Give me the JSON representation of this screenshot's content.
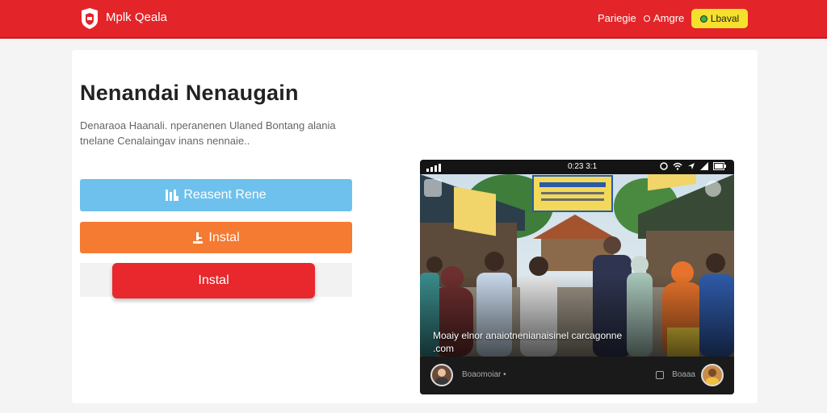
{
  "header": {
    "brand": "Mplk Qeala",
    "nav": [
      "Pariegie",
      "Amgre"
    ],
    "button_label": "Lbaval",
    "background": "#e32428",
    "button_color": "#f5e02e"
  },
  "main": {
    "title": "Nenandai Nenaugain",
    "description": "Denaraoa Haanali. nperanenen Ulaned Bontang alania tnelane Cenalaingav inans nennaie..",
    "buttons": [
      {
        "label": "Reasent Rene",
        "icon": "app-grid-icon",
        "color": "#6ec1ec"
      },
      {
        "label": "Instal",
        "icon": "download-icon",
        "color": "#f57a32"
      },
      {
        "label": "Instal",
        "icon": "",
        "color": "#e8282c"
      }
    ]
  },
  "preview": {
    "status_time": "0:23 3:1",
    "caption": "Moaiy elnor anaiotnenianaisinel carcagonne .com",
    "bottom_left_meta": "Boaomoiar  •",
    "bottom_right_meta": "Boaaa"
  }
}
